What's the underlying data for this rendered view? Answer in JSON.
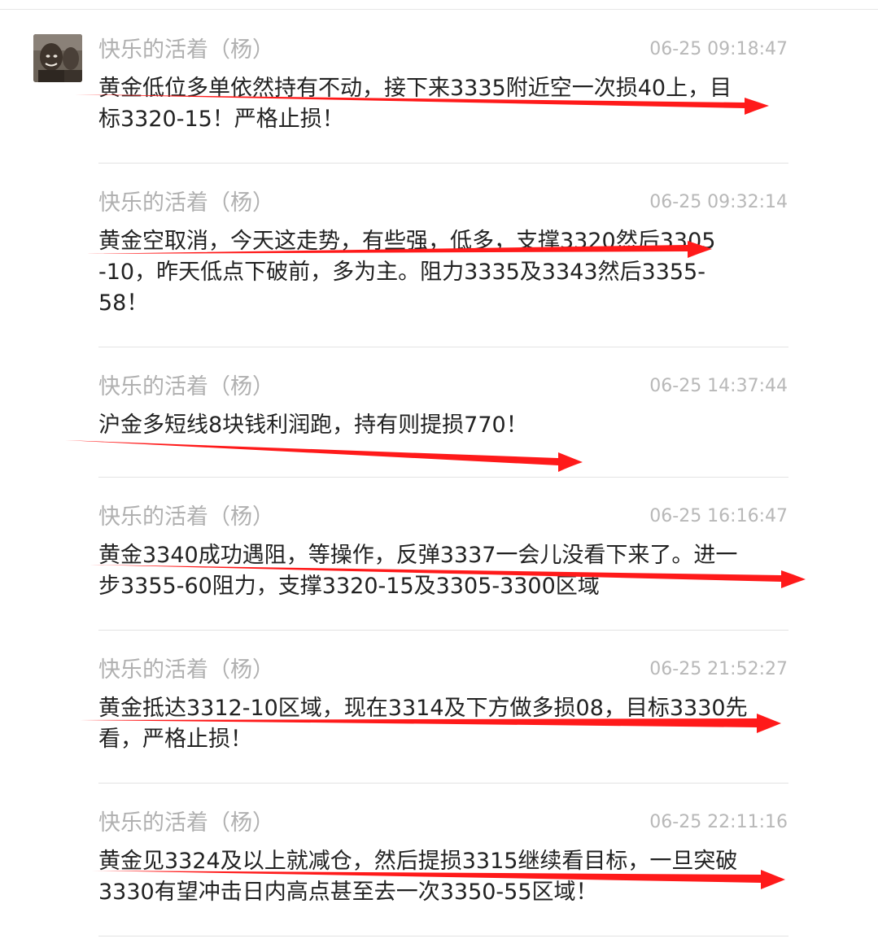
{
  "colors": {
    "name": "#b0b0b0",
    "time": "#b8b8b8",
    "text": "#222222",
    "arrow": "#ff1a1a",
    "divider": "#e3e3e3"
  },
  "avatar": {
    "icon": "user-avatar-photo"
  },
  "messages": [
    {
      "name": "快乐的活着（杨）",
      "time": "06-25 09:18:47",
      "text": "黄金低位多单依然持有不动，接下来3335附近空一次损40上，目标3320-15！严格止损！"
    },
    {
      "name": "快乐的活着（杨）",
      "time": "06-25 09:32:14",
      "text": "黄金空取消，今天这走势，有些强，低多，支撑3320然后3305-10，昨天低点下破前，多为主。阻力3335及3343然后3355-58！"
    },
    {
      "name": "快乐的活着（杨）",
      "time": "06-25 14:37:44",
      "text": "沪金多短线8块钱利润跑，持有则提损770！"
    },
    {
      "name": "快乐的活着（杨）",
      "time": "06-25 16:16:47",
      "text": "黄金3340成功遇阻，等操作，反弹3337一会儿没看下来了。进一步3355-60阻力，支撑3320-15及3305-3300区域"
    },
    {
      "name": "快乐的活着（杨）",
      "time": "06-25 21:52:27",
      "text": "黄金抵达3312-10区域，现在3314及下方做多损08，目标3330先看，严格止损！"
    },
    {
      "name": "快乐的活着（杨）",
      "time": "06-25 22:11:16",
      "text": "黄金见3324及以上就减仓，然后提损3315继续看目标，一旦突破3330有望冲击日内高点甚至去一次3350-55区域！"
    }
  ]
}
